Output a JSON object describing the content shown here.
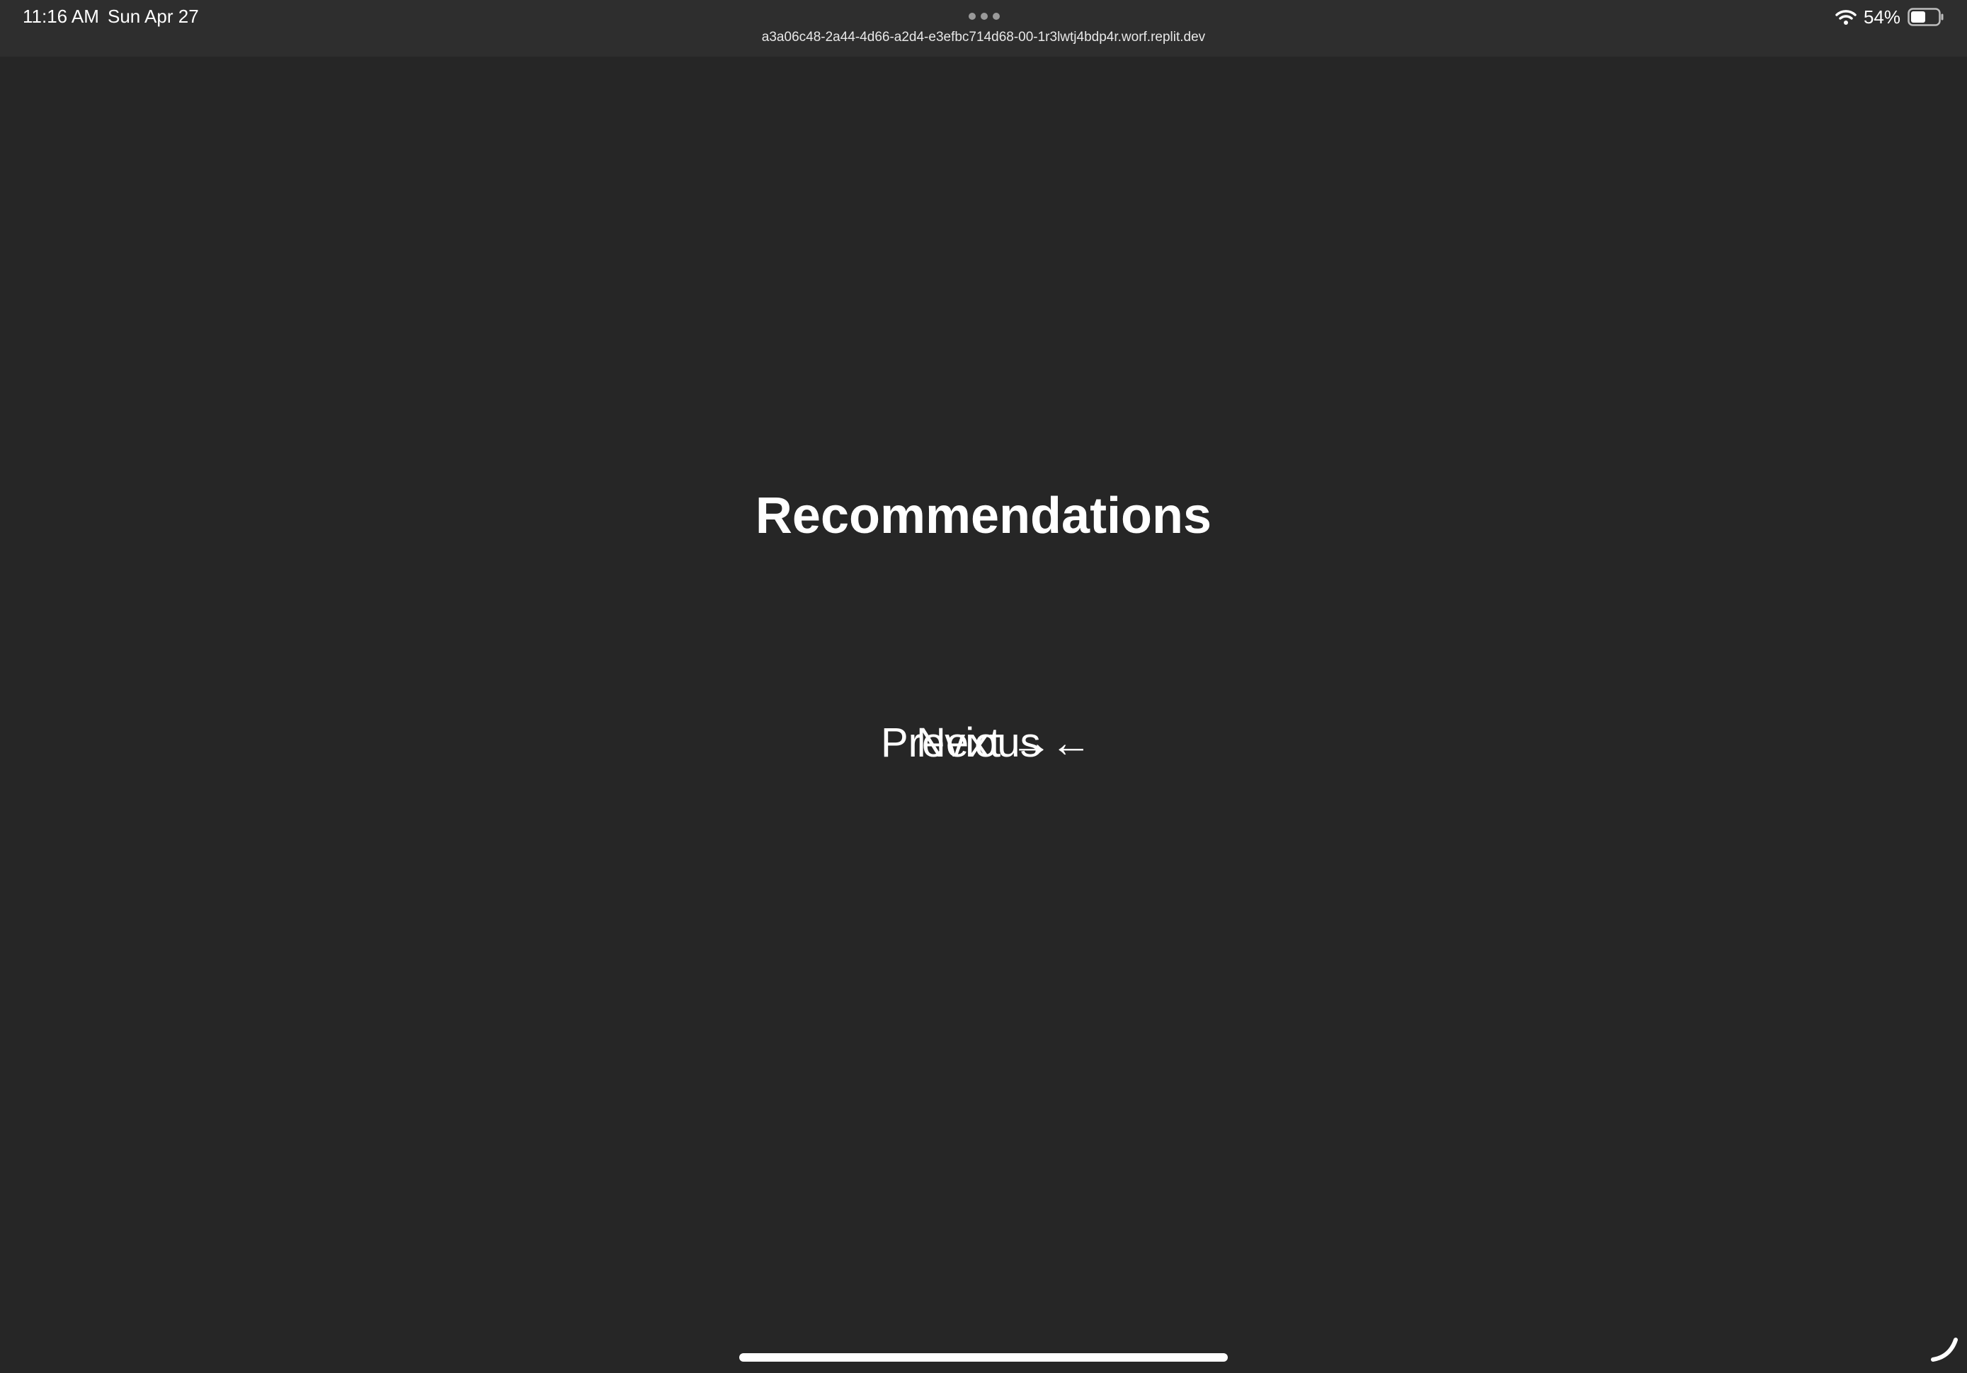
{
  "status_bar": {
    "time": "11:16 AM",
    "date": "Sun Apr 27",
    "url": "a3a06c48-2a44-4d66-a2d4-e3efbc714d68-00-1r3lwtj4bdp4r.worf.replit.dev",
    "battery_percent": "54%",
    "battery_level": 0.54,
    "icons": {
      "multitask": "more-dots-icon",
      "wifi": "wifi-icon",
      "battery": "battery-icon"
    }
  },
  "main": {
    "title": "Recommendations",
    "previous_label": "Previous",
    "previous_arrow": "←",
    "next_label": "Next",
    "next_arrow": "→"
  },
  "colors": {
    "background": "#262626",
    "status_bar": "#2e2e2e",
    "text": "#ffffff"
  }
}
